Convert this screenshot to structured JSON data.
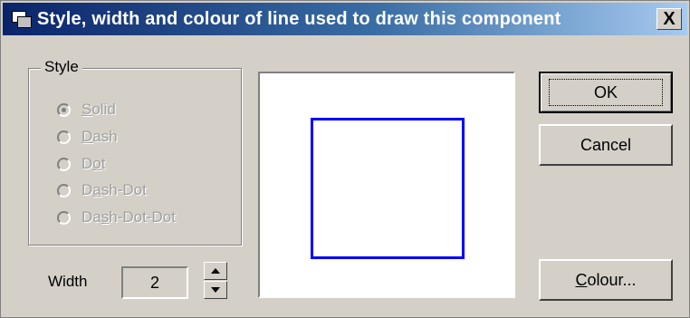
{
  "window": {
    "title": "Style, width and colour of line used to draw this component",
    "close_label": "X"
  },
  "style_group": {
    "label": "Style",
    "options": [
      {
        "label": "Solid",
        "underline": "S",
        "rest": "olid",
        "checked": true
      },
      {
        "label": "Dash",
        "underline": "D",
        "rest": "ash",
        "checked": false
      },
      {
        "label": "Dot",
        "underline": "o",
        "prefix": "D",
        "rest": "t",
        "checked": false
      },
      {
        "label": "Dash-Dot",
        "underline": "a",
        "prefix": "D",
        "rest": "sh-Dot",
        "checked": false
      },
      {
        "label": "Dash-Dot-Dot",
        "underline": "s",
        "prefix": "Da",
        "rest": "h-Dot-Dot",
        "checked": false
      }
    ],
    "enabled": false
  },
  "width": {
    "label": "Width",
    "value": "2"
  },
  "preview": {
    "line_color": "#0000ff"
  },
  "buttons": {
    "ok": "OK",
    "cancel": "Cancel",
    "colour": "Colour..."
  },
  "colors": {
    "title_start": "#0a246a",
    "title_end": "#a6caf0",
    "face": "#d4d0c8"
  }
}
